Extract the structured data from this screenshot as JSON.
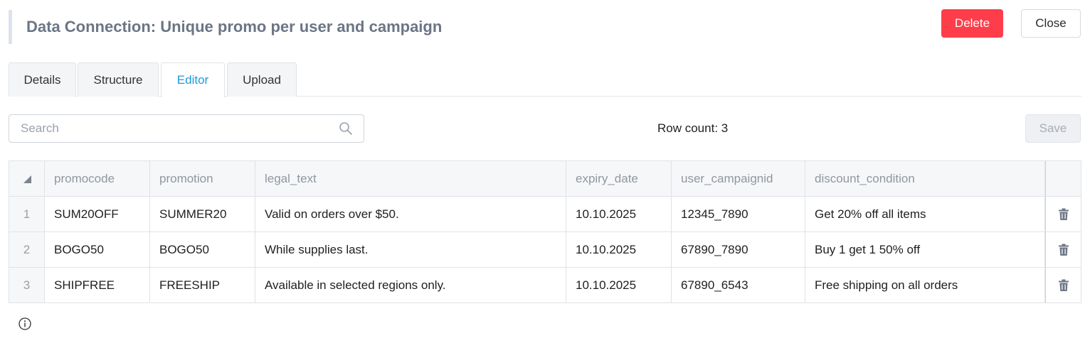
{
  "header": {
    "title": "Data Connection: Unique promo per user and campaign",
    "delete_label": "Delete",
    "close_label": "Close"
  },
  "tabs": [
    {
      "label": "Details",
      "active": false
    },
    {
      "label": "Structure",
      "active": false
    },
    {
      "label": "Editor",
      "active": true
    },
    {
      "label": "Upload",
      "active": false
    }
  ],
  "toolbar": {
    "search_placeholder": "Search",
    "row_count": "Row count: 3",
    "save_label": "Save"
  },
  "table": {
    "columns": [
      "promocode",
      "promotion",
      "legal_text",
      "expiry_date",
      "user_campaignid",
      "discount_condition"
    ],
    "rows": [
      {
        "num": "1",
        "promocode": "SUM20OFF",
        "promotion": "SUMMER20",
        "legal_text": "Valid on orders over $50.",
        "expiry_date": "10.10.2025",
        "user_campaignid": "12345_7890",
        "discount_condition": "Get 20% off all items"
      },
      {
        "num": "2",
        "promocode": "BOGO50",
        "promotion": "BOGO50",
        "legal_text": "While supplies last.",
        "expiry_date": "10.10.2025",
        "user_campaignid": "67890_7890",
        "discount_condition": "Buy 1 get 1 50% off"
      },
      {
        "num": "3",
        "promocode": "SHIPFREE",
        "promotion": "FREESHIP",
        "legal_text": "Available in selected regions only.",
        "expiry_date": "10.10.2025",
        "user_campaignid": "67890_6543",
        "discount_condition": "Free shipping on all orders"
      }
    ]
  },
  "colors": {
    "accent": "#1e9ad6",
    "danger": "#fd3e4a"
  },
  "icons": [
    "search-icon",
    "sort-corner-icon",
    "trash-icon",
    "info-icon"
  ]
}
